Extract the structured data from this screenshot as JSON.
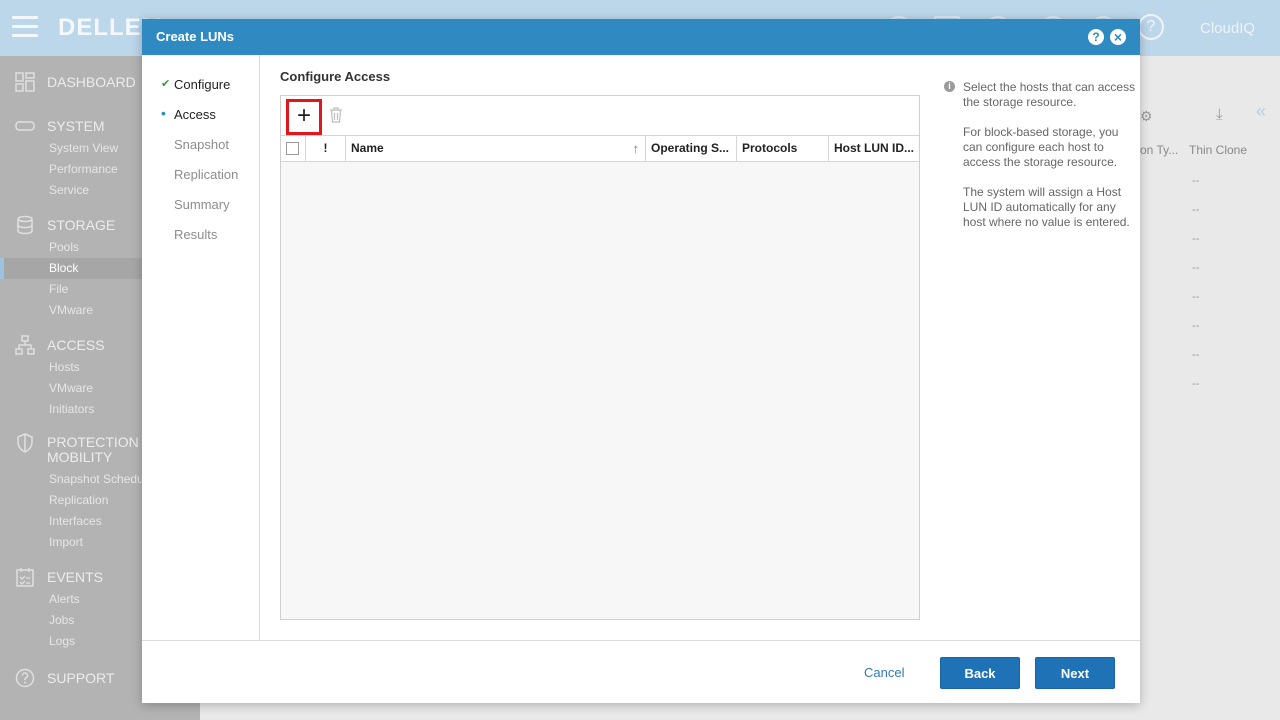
{
  "app": {
    "logo_text": "DELLEM",
    "cloudiq_label": "CloudIQ",
    "help_glyph": "?"
  },
  "sidebar": {
    "sections": [
      {
        "title": "DASHBOARD",
        "icon": "dashboard-grid-icon",
        "items": []
      },
      {
        "title": "SYSTEM",
        "icon": "system-drive-icon",
        "items": [
          "System View",
          "Performance",
          "Service"
        ]
      },
      {
        "title": "STORAGE",
        "icon": "database-icon",
        "items": [
          "Pools",
          "Block",
          "File",
          "VMware"
        ],
        "active_item": "Block"
      },
      {
        "title": "ACCESS",
        "icon": "network-hierarchy-icon",
        "items": [
          "Hosts",
          "VMware",
          "Initiators"
        ]
      },
      {
        "title": "PROTECTION &",
        "title2": "MOBILITY",
        "icon": "shield-icon",
        "items": [
          "Snapshot Schedu",
          "Replication",
          "Interfaces",
          "Import"
        ]
      },
      {
        "title": "EVENTS",
        "icon": "clipboard-check-icon",
        "items": [
          "Alerts",
          "Jobs",
          "Logs"
        ]
      },
      {
        "title": "SUPPORT",
        "icon": "question-circle-icon",
        "items": []
      }
    ]
  },
  "background_table": {
    "columns": [
      "on Ty...",
      "Thin Clone"
    ],
    "dash_values": [
      "--",
      "--",
      "--",
      "--",
      "--",
      "--",
      "--",
      "--"
    ]
  },
  "modal": {
    "title": "Create LUNs",
    "help_glyph": "?",
    "close_glyph": "×",
    "steps": [
      {
        "label": "Configure",
        "state": "done",
        "mark": "✔"
      },
      {
        "label": "Access",
        "state": "current",
        "mark": "•"
      },
      {
        "label": "Snapshot",
        "state": "pending"
      },
      {
        "label": "Replication",
        "state": "pending"
      },
      {
        "label": "Summary",
        "state": "pending"
      },
      {
        "label": "Results",
        "state": "pending"
      }
    ],
    "section_title": "Configure Access",
    "toolbar": {
      "add_glyph": "+"
    },
    "table": {
      "columns": [
        "!",
        "Name",
        "Operating S...",
        "Protocols",
        "Host LUN ID..."
      ],
      "sort_glyph": "↑",
      "rows": []
    },
    "help": {
      "info_glyph": "i",
      "paragraphs": [
        "Select the hosts that can access the storage resource.",
        "For block-based storage, you can configure each host to access the storage resource.",
        "The system will assign a Host LUN ID automatically for any host where no value is entered."
      ]
    },
    "footer": {
      "cancel_label": "Cancel",
      "back_label": "Back",
      "next_label": "Next"
    }
  },
  "colors": {
    "header_blue": "#2f8ac2",
    "button_blue": "#1f72b5",
    "highlight_red": "#e0181e",
    "check_green": "#2e9c3e"
  }
}
